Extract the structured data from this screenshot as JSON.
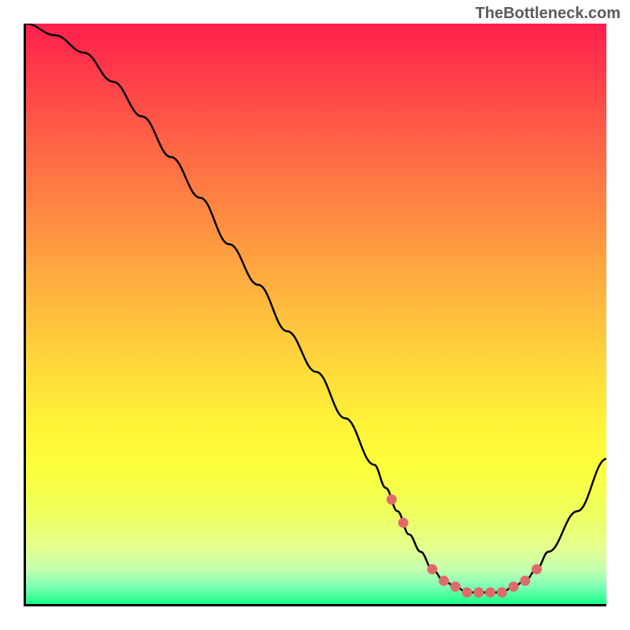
{
  "attribution": "TheBottleneck.com",
  "chart_data": {
    "type": "line",
    "title": "",
    "xlabel": "",
    "ylabel": "",
    "xlim": [
      0,
      100
    ],
    "ylim": [
      0,
      100
    ],
    "series": [
      {
        "name": "bottleneck-curve",
        "x": [
          0,
          5,
          10,
          15,
          20,
          25,
          30,
          35,
          40,
          45,
          50,
          55,
          60,
          62,
          64,
          66,
          68,
          70,
          72,
          74,
          76,
          78,
          80,
          82,
          84,
          86,
          88,
          90,
          95,
          100
        ],
        "y": [
          100,
          98,
          95,
          90,
          84,
          77,
          70,
          62,
          55,
          47,
          40,
          32,
          24,
          20,
          16,
          12,
          9,
          6,
          4,
          3,
          2,
          2,
          2,
          2,
          3,
          4,
          6,
          9,
          16,
          25
        ]
      }
    ],
    "marker_points": {
      "name": "highlighted-points",
      "x": [
        63,
        65,
        70,
        72,
        74,
        76,
        78,
        80,
        82,
        84,
        86,
        88
      ],
      "y": [
        18,
        14,
        6,
        4,
        3,
        2,
        2,
        2,
        2,
        3,
        4,
        6
      ]
    },
    "gradient_stops": [
      {
        "pos": 0,
        "color": "#ff1f4c"
      },
      {
        "pos": 50,
        "color": "#ffc43d"
      },
      {
        "pos": 80,
        "color": "#fdff3a"
      },
      {
        "pos": 100,
        "color": "#18ff85"
      }
    ]
  }
}
